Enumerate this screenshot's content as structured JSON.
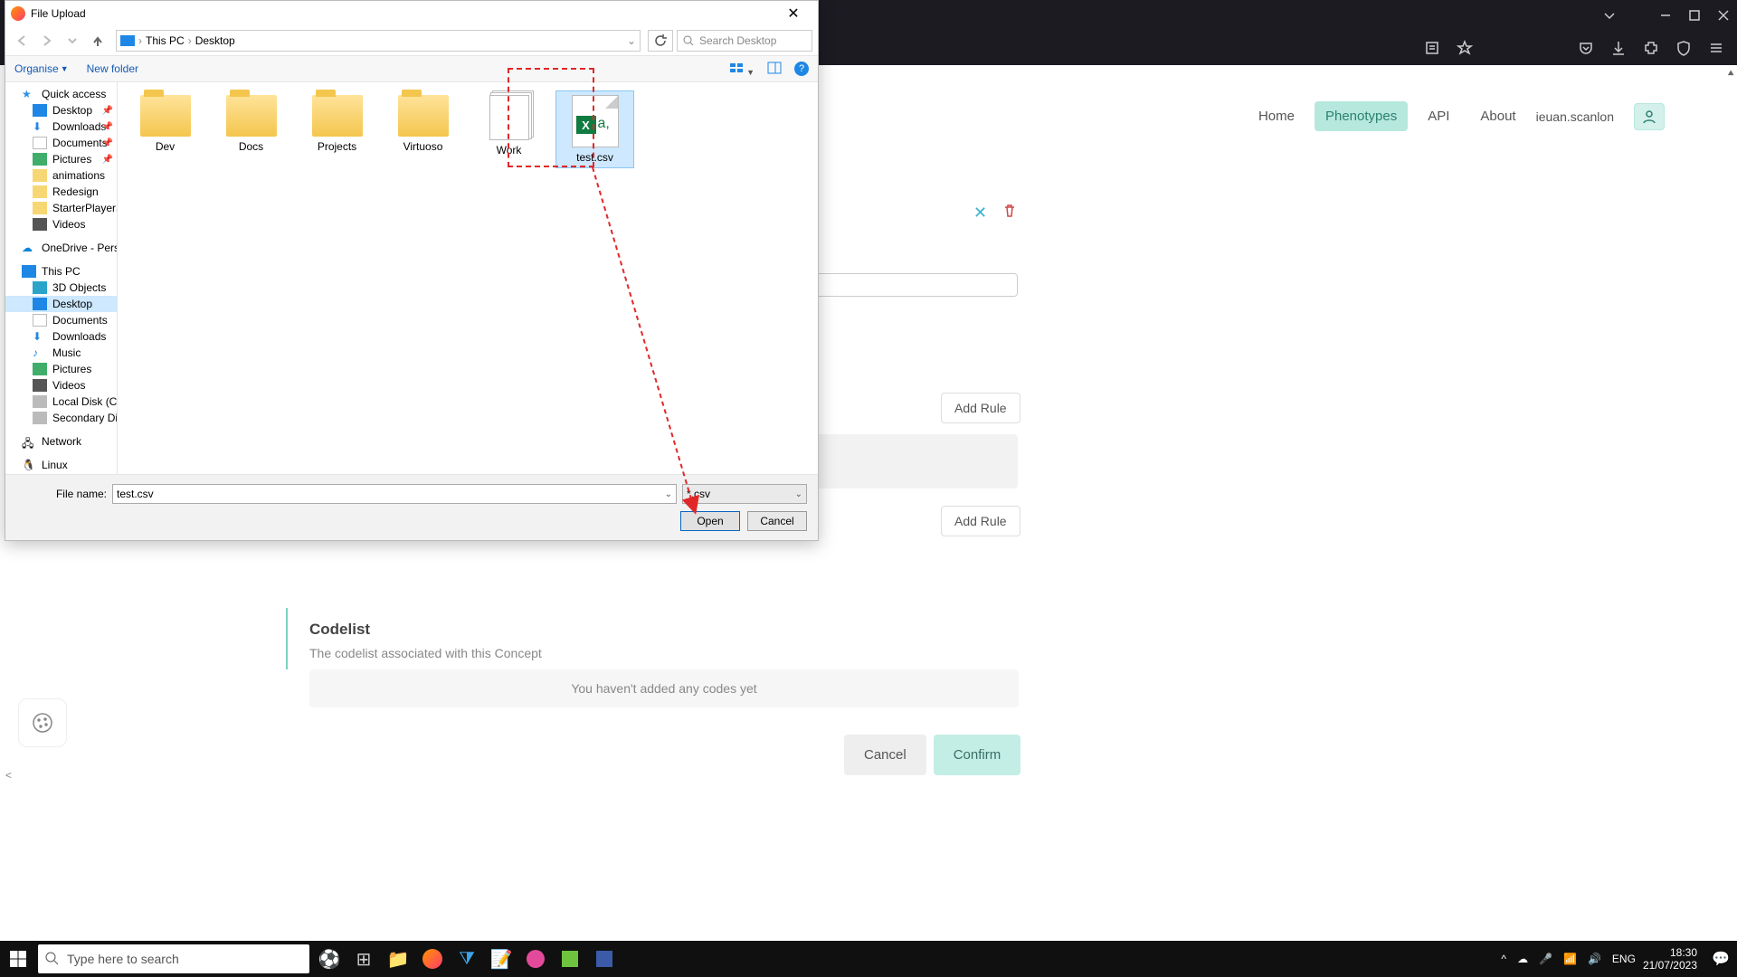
{
  "chrome": {},
  "webpage": {
    "nav": {
      "home": "Home",
      "phenotypes": "Phenotypes",
      "api": "API",
      "about": "About",
      "username": "ieuan.scanlon"
    },
    "add_rule_label": "Add Rule",
    "codelist": {
      "heading": "Codelist",
      "sub": "The codelist associated with this Concept",
      "empty_msg": "You haven't added any codes yet"
    },
    "btn_cancel": "Cancel",
    "btn_confirm": "Confirm"
  },
  "dialog": {
    "title": "File Upload",
    "breadcrumb": {
      "root": "This PC",
      "leaf": "Desktop"
    },
    "search_placeholder": "Search Desktop",
    "toolbar": {
      "organise": "Organise",
      "new_folder": "New folder"
    },
    "sidebar": {
      "quick_access": "Quick access",
      "desktop": "Desktop",
      "downloads": "Downloads",
      "documents": "Documents",
      "pictures": "Pictures",
      "animations": "animations",
      "redesign": "Redesign",
      "starterplayerscripts": "StarterPlayerScripts",
      "videos": "Videos",
      "onedrive": "OneDrive - Personal",
      "this_pc": "This PC",
      "objects3d": "3D Objects",
      "desktop2": "Desktop",
      "documents2": "Documents",
      "downloads2": "Downloads",
      "music": "Music",
      "pictures2": "Pictures",
      "videos2": "Videos",
      "local_disk": "Local Disk (C:)",
      "secondary_disk": "Secondary Disk (D:)",
      "network": "Network",
      "linux": "Linux"
    },
    "files": {
      "dev": "Dev",
      "docs": "Docs",
      "projects": "Projects",
      "virtuoso": "Virtuoso",
      "work": "Work",
      "testcsv": "test.csv"
    },
    "footer": {
      "file_name_label": "File name:",
      "file_name_value": "test.csv",
      "filter_value": "*.csv",
      "open": "Open",
      "cancel": "Cancel"
    }
  },
  "taskbar": {
    "search_placeholder": "Type here to search",
    "time": "18:30",
    "date": "21/07/2023"
  }
}
